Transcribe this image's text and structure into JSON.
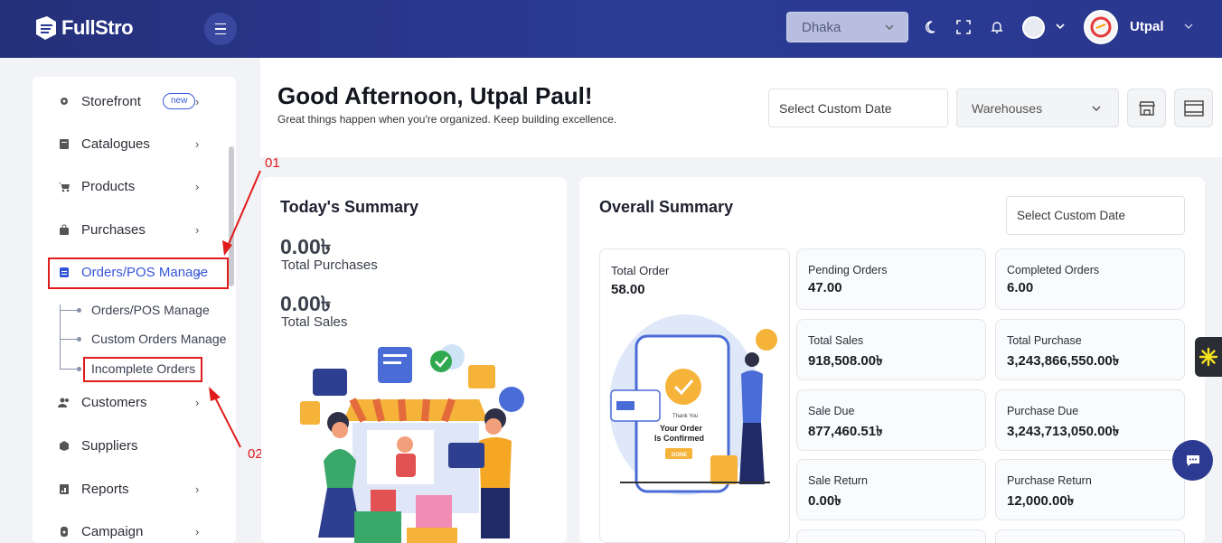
{
  "app": {
    "logo_text": "FullStro"
  },
  "topbar": {
    "branch": "Dhaka",
    "user_name": "Utpal"
  },
  "sidebar": {
    "items": [
      {
        "label": "Storefront",
        "badge": "new"
      },
      {
        "label": "Catalogues"
      },
      {
        "label": "Products"
      },
      {
        "label": "Purchases"
      },
      {
        "label": "Orders/POS Manage"
      },
      {
        "label": "Customers"
      },
      {
        "label": "Suppliers"
      },
      {
        "label": "Reports"
      },
      {
        "label": "Campaign"
      }
    ],
    "sub_items": [
      {
        "label": "Orders/POS Manage"
      },
      {
        "label": "Custom Orders Manage"
      },
      {
        "label": "Incomplete Orders"
      }
    ]
  },
  "annotations": {
    "step1": "01",
    "step2": "02"
  },
  "header": {
    "greeting": "Good Afternoon, Utpal Paul!",
    "subtitle": "Great things happen when you're organized. Keep building excellence.",
    "date_placeholder": "Select Custom Date",
    "warehouse": "Warehouses"
  },
  "today": {
    "title": "Today's Summary",
    "purchases_amount": "0.00৳",
    "purchases_label": "Total Purchases",
    "sales_amount": "0.00৳",
    "sales_label": "Total Sales"
  },
  "overall": {
    "title": "Overall Summary",
    "date_placeholder": "Select Custom Date",
    "total_order_label": "Total Order",
    "total_order_value": "58.00",
    "illustration_text": {
      "thanks": "Thank You",
      "line1": "Your Order",
      "line2": "Is Confirmed",
      "done": "DONE"
    },
    "stats": [
      {
        "label": "Pending Orders",
        "value": "47.00"
      },
      {
        "label": "Completed Orders",
        "value": "6.00"
      },
      {
        "label": "Total Sales",
        "value": "918,508.00৳"
      },
      {
        "label": "Total Purchase",
        "value": "3,243,866,550.00৳"
      },
      {
        "label": "Sale Due",
        "value": "877,460.51৳"
      },
      {
        "label": "Purchase Due",
        "value": "3,243,713,050.00৳"
      },
      {
        "label": "Sale Return",
        "value": "0.00৳"
      },
      {
        "label": "Purchase Return",
        "value": "12,000.00৳"
      }
    ]
  },
  "colors": {
    "topbar": "#2b3a94",
    "accent": "#3656d8",
    "annotation": "#e11b1b"
  }
}
